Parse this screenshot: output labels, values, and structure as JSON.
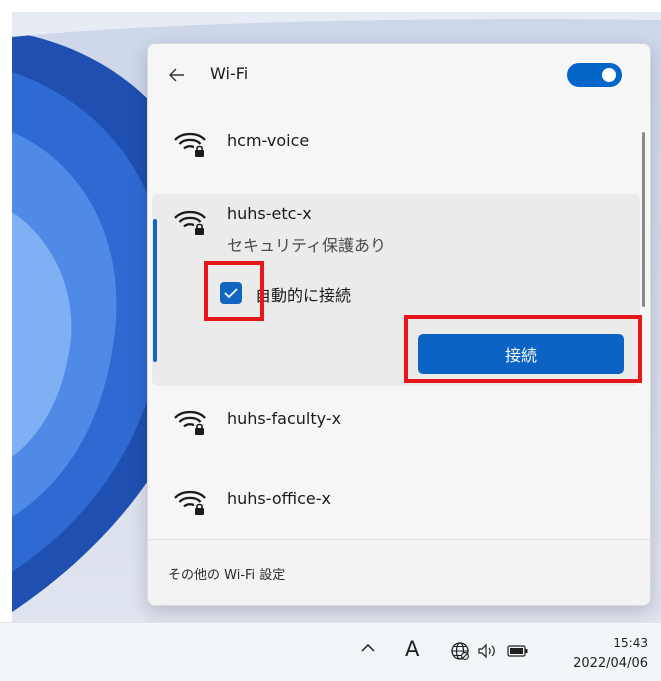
{
  "flyout": {
    "title": "Wi-Fi",
    "wifi_enabled": true,
    "networks": [
      {
        "ssid": "hcm-voice",
        "secured": true
      },
      {
        "ssid": "huhs-etc-x",
        "secured": true,
        "status": "セキュリティ保護あり",
        "expanded": true
      },
      {
        "ssid": "huhs-faculty-x",
        "secured": true
      },
      {
        "ssid": "huhs-office-x",
        "secured": true
      }
    ],
    "auto_connect": {
      "label": "自動的に接続",
      "checked": true
    },
    "connect_button": "接続",
    "footer_link": "その他の Wi-Fi 設定"
  },
  "taskbar": {
    "input_indicator": "A",
    "time": "15:43",
    "date": "2022/04/06"
  },
  "icons": [
    "back-arrow-icon",
    "wifi-lock-icon",
    "checkmark-icon",
    "chevron-up-icon",
    "globe-icon",
    "speaker-icon",
    "battery-icon"
  ],
  "colors": {
    "accent": "#0b64c4",
    "highlight": "#e6161a"
  }
}
